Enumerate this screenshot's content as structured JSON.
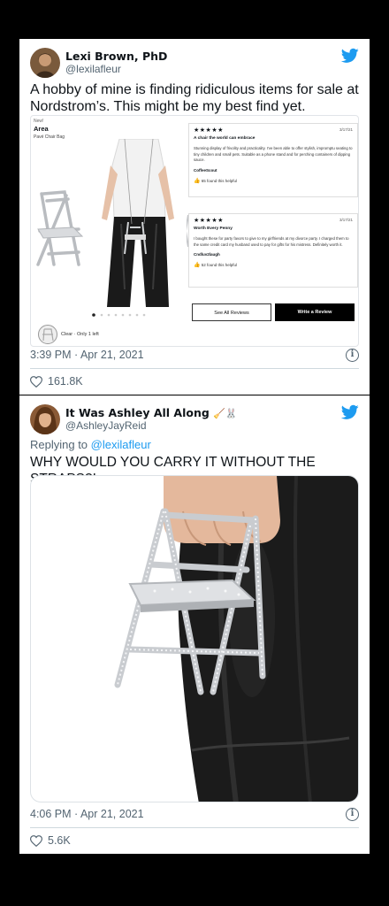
{
  "tweet1": {
    "user_name": "Lexi Brown, PhD",
    "handle": "@lexilafleur",
    "text": "A hobby of mine is finding ridiculous items for sale at Nordstrom’s. This might be my best find yet.",
    "timestamp": "3:39 PM · Apr 21, 2021",
    "likes": "161.8K",
    "listing": {
      "badge": "New!",
      "title": "Area",
      "subtitle": "Pavé Chair Bag",
      "stock": "Clear · Only 1 left",
      "see_all": "See All Reviews",
      "write": "Write a Review",
      "reviews": [
        {
          "stars": "★★★★★",
          "date": "3/17/21",
          "title": "A chair the world can embrace",
          "body": "Stunning display of frivolity and practicality. I've been able to offer stylish, impromptu  seating to tiny children and small pets. Suitable as a phone stand and for perching containers of dipping sauce.",
          "author": "CoffeeScout",
          "helpful": "65 found this helpful"
        },
        {
          "stars": "★★★★★",
          "date": "3/17/21",
          "title": "Worth Every Penny",
          "body": "I bought these for party favors to give to my girlfriends at my divorce party.  I charged them to the same credit card my husband used to pay for gifts for his mistress.  Definitely worth it.",
          "author": "Cndluv2laugh",
          "helpful": "52 found this helpful"
        }
      ]
    }
  },
  "tweet2": {
    "user_name": "It Was Ashley All Along",
    "name_emoji": "🧹🐰",
    "handle": "@AshleyJayReid",
    "replying_prefix": "Replying to",
    "replying_to": "@lexilafleur",
    "text": "WHY WOULD YOU CARRY IT WITHOUT THE STRAPS?!",
    "timestamp": "4:06 PM · Apr 21, 2021",
    "likes": "5.6K"
  },
  "icons": {
    "bird": "twitter-bird-icon",
    "info": "info-icon",
    "heart": "heart-icon",
    "thumb": "thumbs-up-icon"
  },
  "colors": {
    "twitter_blue": "#1d9bf0",
    "secondary_text": "#536471",
    "link": "#1d9bf0"
  }
}
